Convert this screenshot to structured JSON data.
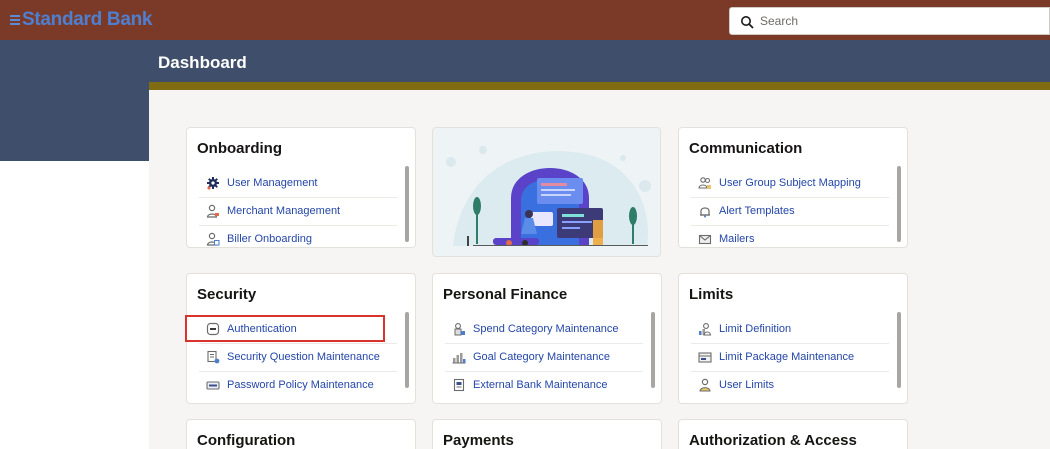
{
  "topbar": {
    "brand": "Standard Bank",
    "search_placeholder": "Search"
  },
  "page": {
    "title": "Dashboard"
  },
  "cards": {
    "onboarding": {
      "title": "Onboarding",
      "items": [
        {
          "label": "User Management",
          "icon": "gear-users-icon"
        },
        {
          "label": "Merchant Management",
          "icon": "merchant-user-icon"
        },
        {
          "label": "Biller Onboarding",
          "icon": "biller-user-icon"
        }
      ]
    },
    "communication": {
      "title": "Communication",
      "items": [
        {
          "label": "User Group Subject Mapping",
          "icon": "user-group-icon"
        },
        {
          "label": "Alert Templates",
          "icon": "bell-icon"
        },
        {
          "label": "Mailers",
          "icon": "mail-icon"
        }
      ]
    },
    "security": {
      "title": "Security",
      "items": [
        {
          "label": "Authentication",
          "icon": "shield-icon"
        },
        {
          "label": "Security Question Maintenance",
          "icon": "question-doc-icon"
        },
        {
          "label": "Password Policy Maintenance",
          "icon": "password-icon"
        }
      ]
    },
    "personal_finance": {
      "title": "Personal Finance",
      "items": [
        {
          "label": "Spend Category Maintenance",
          "icon": "spend-icon"
        },
        {
          "label": "Goal Category Maintenance",
          "icon": "goal-bars-icon"
        },
        {
          "label": "External Bank Maintenance",
          "icon": "bank-doc-icon"
        }
      ]
    },
    "limits": {
      "title": "Limits",
      "items": [
        {
          "label": "Limit Definition",
          "icon": "limit-chart-icon"
        },
        {
          "label": "Limit Package Maintenance",
          "icon": "package-icon"
        },
        {
          "label": "User Limits",
          "icon": "user-limit-icon"
        }
      ]
    },
    "configuration": {
      "title": "Configuration"
    },
    "payments": {
      "title": "Payments"
    },
    "authorization": {
      "title": "Authorization & Access"
    }
  },
  "colors": {
    "topbar": "#7b3a28",
    "brand": "#4f7fd0",
    "band": "#3f4f6b",
    "panel_border": "#7f6c12",
    "link": "#2446a8",
    "highlight": "#d9342b"
  }
}
